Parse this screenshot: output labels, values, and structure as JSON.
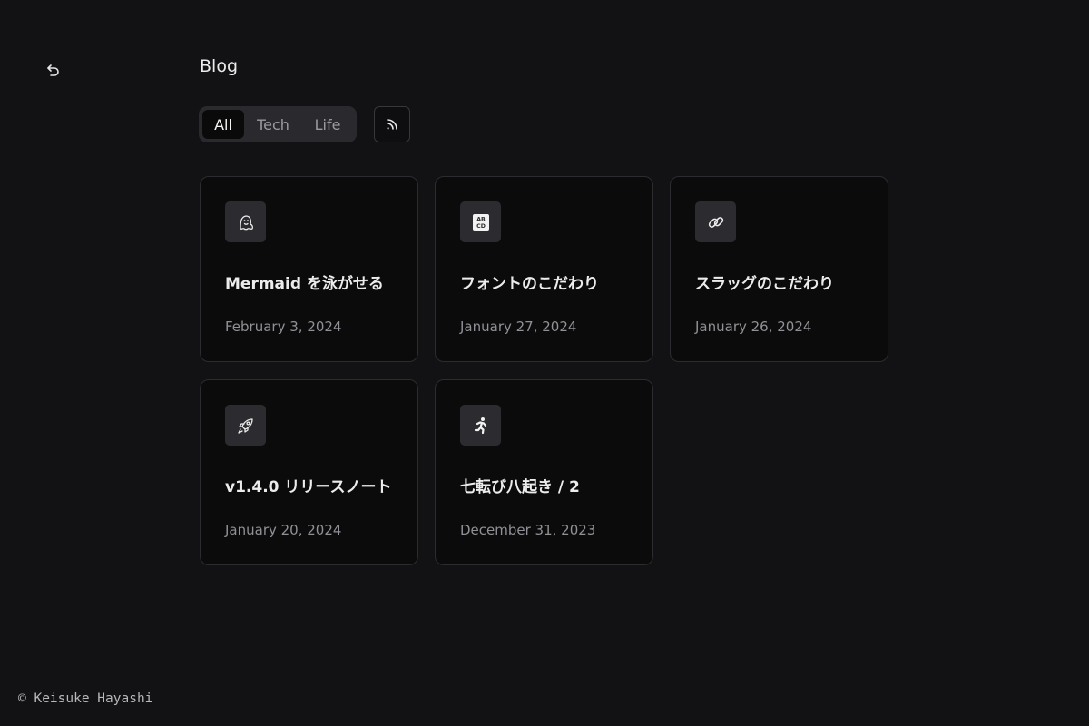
{
  "header": {
    "title": "Blog",
    "back_icon": "undo-arrow-icon"
  },
  "filter_tabs": [
    {
      "label": "All",
      "active": true
    },
    {
      "label": "Tech",
      "active": false
    },
    {
      "label": "Life",
      "active": false
    }
  ],
  "rss": {
    "icon": "rss-icon"
  },
  "posts": [
    {
      "icon": "ghost-icon",
      "title": "Mermaid を泳がせる",
      "date": "February 3, 2024"
    },
    {
      "icon": "abcd-icon",
      "title": "フォントのこだわり",
      "date": "January 27, 2024"
    },
    {
      "icon": "link-icon",
      "title": "スラッグのこだわり",
      "date": "January 26, 2024"
    },
    {
      "icon": "rocket-icon",
      "title": "v1.4.0 リリースノート",
      "date": "January 20, 2024"
    },
    {
      "icon": "running-person-icon",
      "title": "七転び八起き / 2",
      "date": "December 31, 2023"
    }
  ],
  "footer": {
    "text": "© Keisuke Hayashi"
  },
  "colors": {
    "background": "#121214",
    "card_background": "#0b0b0c",
    "card_border": "#2c2c30",
    "text": "#ececec",
    "muted_text": "#909096"
  }
}
